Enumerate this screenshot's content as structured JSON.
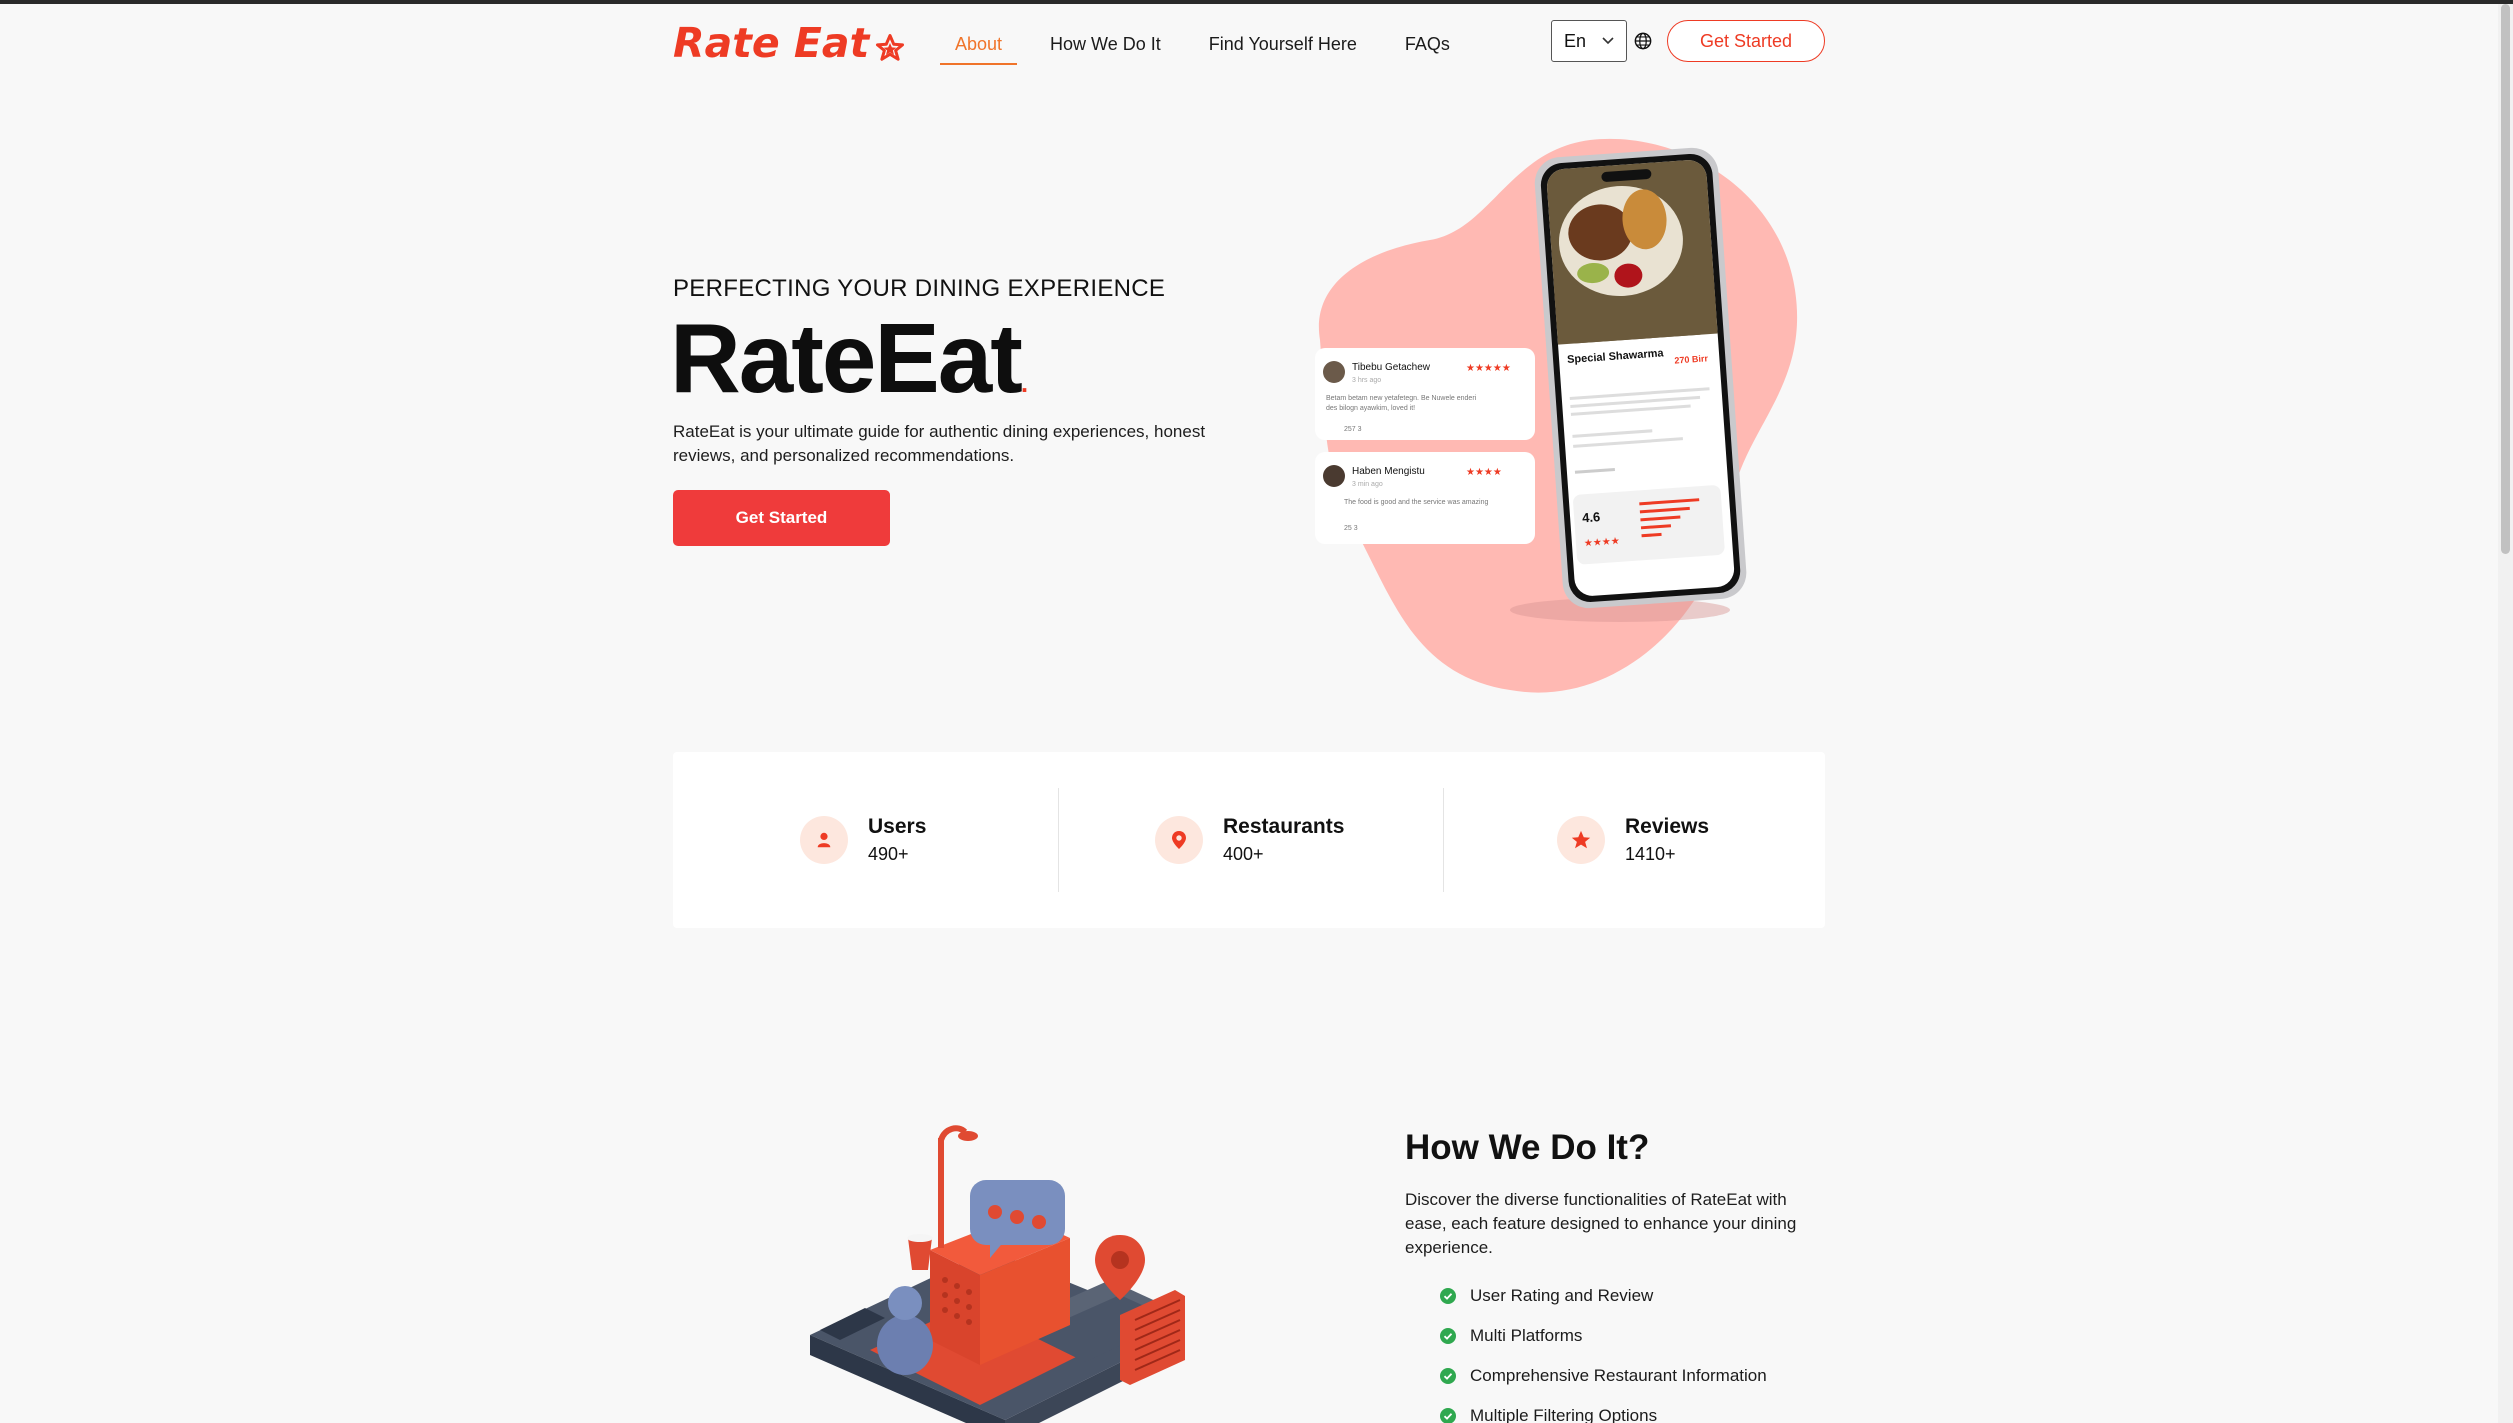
{
  "nav": {
    "logo_text": "Rate Eat",
    "links": [
      {
        "label": "About",
        "active": true
      },
      {
        "label": "How We Do It",
        "active": false
      },
      {
        "label": "Find Yourself Here",
        "active": false
      },
      {
        "label": "FAQs",
        "active": false
      }
    ],
    "language": "En",
    "cta_label": "Get Started"
  },
  "hero": {
    "kicker": "PERFECTING YOUR DINING EXPERIENCE",
    "title": "RateEat",
    "title_dot": ".",
    "description": "RateEat is your ultimate guide for authentic dining experiences, honest reviews, and personalized recommendations.",
    "cta_label": "Get Started",
    "mockup": {
      "review1": {
        "name": "Tibebu Getachew",
        "time": "3 hrs ago",
        "text": "Betam betam new yetafetegn. Be Nuwele enderi des bilogn ayawkim, loved it!",
        "likes": "257",
        "dislikes": "3"
      },
      "review2": {
        "name": "Haben Mengistu",
        "time": "3 min ago",
        "text": "The food is good and the service was amazing",
        "likes": "25",
        "dislikes": "3"
      },
      "dish": {
        "name": "Special Shawarma",
        "price": "270 Birr",
        "rating": "4.6"
      }
    }
  },
  "stats": [
    {
      "label": "Users",
      "value": "490+",
      "icon": "user-icon"
    },
    {
      "label": "Restaurants",
      "value": "400+",
      "icon": "location-pin-icon"
    },
    {
      "label": "Reviews",
      "value": "1410+",
      "icon": "star-icon"
    }
  ],
  "how": {
    "title": "How We Do It?",
    "description": "Discover the diverse functionalities of RateEat with ease, each feature designed to enhance your dining experience.",
    "features": [
      "User Rating and Review",
      "Multi Platforms",
      "Comprehensive Restaurant Information",
      "Multiple Filtering Options"
    ]
  },
  "colors": {
    "brand": "#ee3b24",
    "accent_nav": "#f0742a",
    "button": "#ef3b3b",
    "check": "#2fa84f",
    "blob": "#ffb9b3"
  }
}
